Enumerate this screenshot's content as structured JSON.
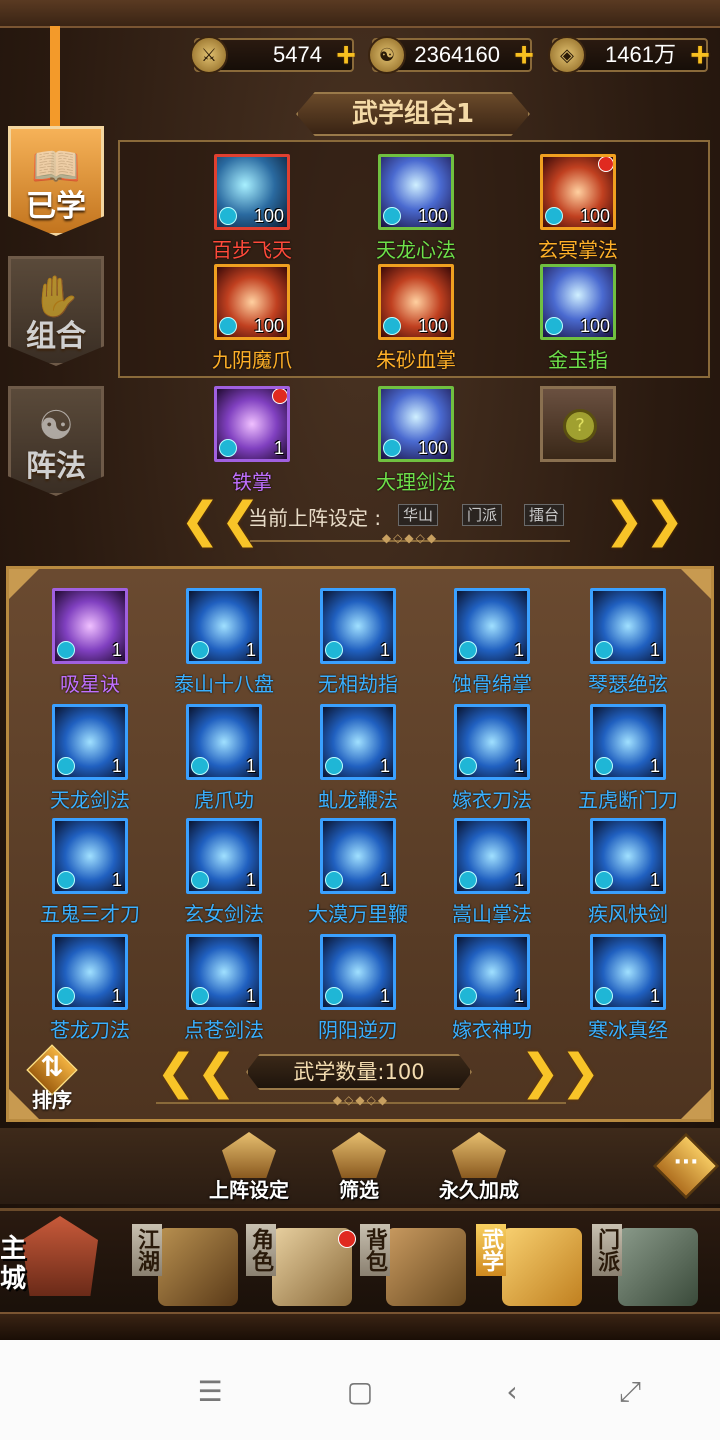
{
  "resources": [
    {
      "icon": "⚔",
      "value": "5474",
      "name": "stamina-resource"
    },
    {
      "icon": "☯",
      "value": "2364160",
      "name": "gold-resource"
    },
    {
      "icon": "◈",
      "value": "1461万",
      "name": "silver-resource"
    }
  ],
  "side_tabs": [
    {
      "label": "已学",
      "glyph": "📖"
    },
    {
      "label": "组合",
      "glyph": "✋"
    },
    {
      "label": "阵法",
      "glyph": "☯"
    }
  ],
  "combo": {
    "title": "武学组合1",
    "slots": [
      {
        "name": "百步飞天",
        "level": "100",
        "rarity": "red"
      },
      {
        "name": "天龙心法",
        "level": "100",
        "rarity": "green"
      },
      {
        "name": "玄冥掌法",
        "level": "100",
        "rarity": "orange",
        "badge": true
      },
      {
        "name": "九阴魔爪",
        "level": "100",
        "rarity": "orange"
      },
      {
        "name": "朱砂血掌",
        "level": "100",
        "rarity": "orange"
      },
      {
        "name": "金玉指",
        "level": "100",
        "rarity": "green"
      },
      {
        "name": "铁掌",
        "level": "1",
        "rarity": "purple",
        "badge": true
      },
      {
        "name": "大理剑法",
        "level": "100",
        "rarity": "green"
      }
    ],
    "locked_icon": "?"
  },
  "deploy": {
    "label": "当前上阵设定 :",
    "chips": [
      "华山",
      "门派",
      "擂台"
    ],
    "prev": "❮❮",
    "next": "❯❯"
  },
  "inventory": {
    "skills": [
      {
        "name": "吸星诀",
        "level": "1",
        "rarity": "purple"
      },
      {
        "name": "泰山十八盘",
        "level": "1",
        "rarity": "blue"
      },
      {
        "name": "无相劫指",
        "level": "1",
        "rarity": "blue"
      },
      {
        "name": "蚀骨绵掌",
        "level": "1",
        "rarity": "blue"
      },
      {
        "name": "琴瑟绝弦",
        "level": "1",
        "rarity": "blue"
      },
      {
        "name": "天龙剑法",
        "level": "1",
        "rarity": "blue"
      },
      {
        "name": "虎爪功",
        "level": "1",
        "rarity": "blue"
      },
      {
        "name": "虬龙鞭法",
        "level": "1",
        "rarity": "blue"
      },
      {
        "name": "嫁衣刀法",
        "level": "1",
        "rarity": "blue"
      },
      {
        "name": "五虎断门刀",
        "level": "1",
        "rarity": "blue"
      },
      {
        "name": "五鬼三才刀",
        "level": "1",
        "rarity": "blue"
      },
      {
        "name": "玄女剑法",
        "level": "1",
        "rarity": "blue"
      },
      {
        "name": "大漠万里鞭",
        "level": "1",
        "rarity": "blue"
      },
      {
        "name": "嵩山掌法",
        "level": "1",
        "rarity": "blue"
      },
      {
        "name": "疾风快剑",
        "level": "1",
        "rarity": "blue"
      },
      {
        "name": "苍龙刀法",
        "level": "1",
        "rarity": "blue"
      },
      {
        "name": "点苍剑法",
        "level": "1",
        "rarity": "blue"
      },
      {
        "name": "阴阳逆刃",
        "level": "1",
        "rarity": "blue"
      },
      {
        "name": "嫁衣神功",
        "level": "1",
        "rarity": "blue"
      },
      {
        "name": "寒冰真经",
        "level": "1",
        "rarity": "blue"
      }
    ],
    "sort_label": "排序",
    "sort_glyph": "⇅",
    "count_label": "武学数量:100",
    "prev": "❮❮",
    "next": "❯❯"
  },
  "actions": [
    {
      "label": "上阵设定"
    },
    {
      "label": "筛选"
    },
    {
      "label": "永久加成"
    }
  ],
  "chat_glyph": "···",
  "nav": {
    "main_city": "主城",
    "items": [
      {
        "label": "江湖"
      },
      {
        "label": "角色",
        "badge": true
      },
      {
        "label": "背包"
      },
      {
        "label": "武学",
        "active": true
      },
      {
        "label": "门派"
      }
    ]
  },
  "system_nav": [
    "☰",
    "▢",
    "‹",
    "⤢"
  ],
  "colors": {
    "accent": "#f8c428",
    "panel": "#4e3420",
    "rarity_red": "#e04030",
    "rarity_green": "#70c040",
    "rarity_orange": "#f0a020",
    "rarity_purple": "#a060e0",
    "rarity_blue": "#3aa0ff"
  }
}
